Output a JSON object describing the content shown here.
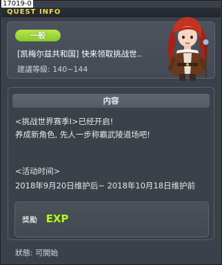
{
  "window": {
    "id_label": "17019-0",
    "title": "QUEST INFO"
  },
  "quest": {
    "category_badge": "一般",
    "name": "[凯梅尔兹共和国] 快来领取挑战世..",
    "level": "建議等級: 140~144"
  },
  "content": {
    "header": "内容",
    "lines": [
      "<挑战世界赛季I>已经开启!",
      "养成新角色, 先人一步称霸武陵道场吧!",
      "",
      "<活动时间>",
      "2018年9月20日维护后~ 2018年10月18日维护前"
    ]
  },
  "reward": {
    "label": "獎勵",
    "icon": "exp-icon",
    "icon_text": "EXP"
  },
  "status": {
    "text": "狀態: 可開始"
  },
  "colors": {
    "title": "#f0d850",
    "badge": "#9fd83a",
    "background": "#3b414a"
  }
}
